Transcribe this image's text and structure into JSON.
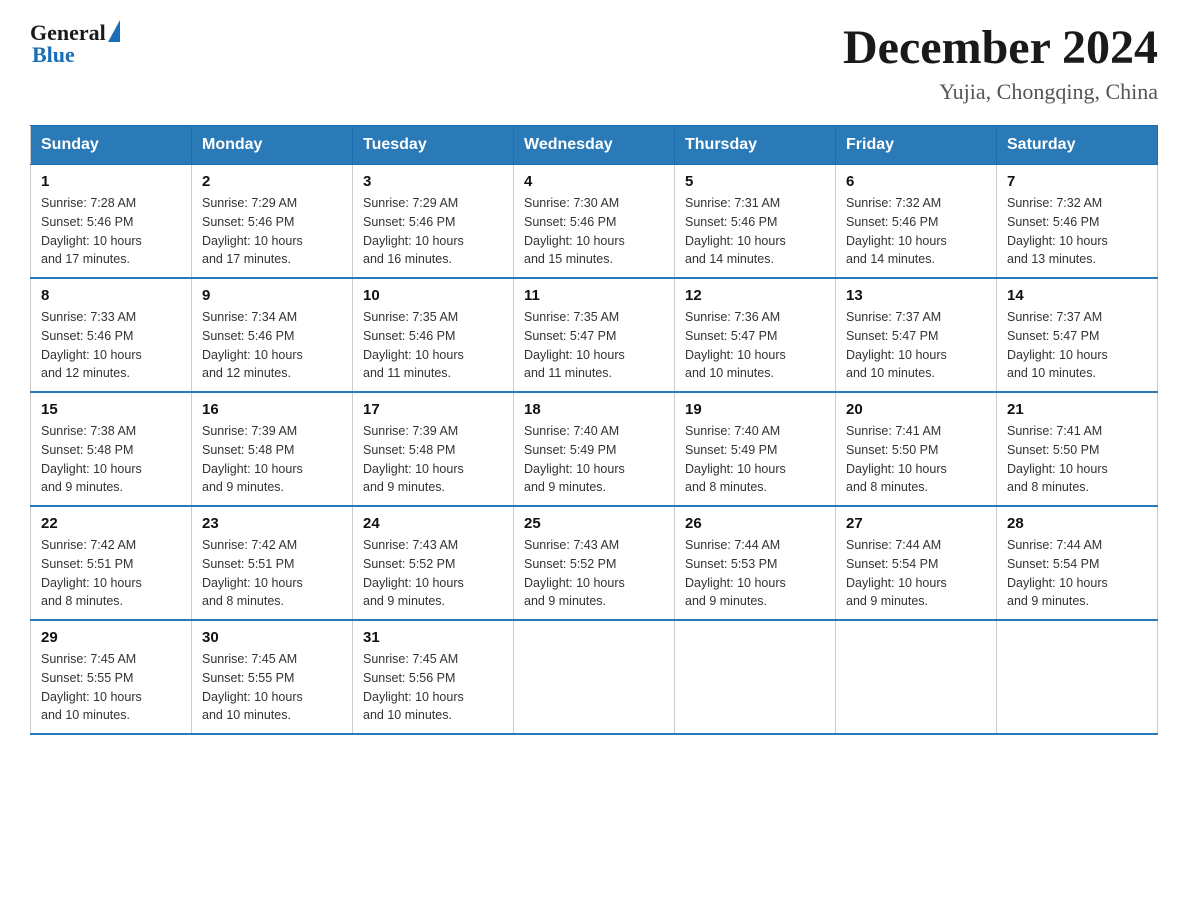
{
  "header": {
    "title": "December 2024",
    "subtitle": "Yujia, Chongqing, China",
    "logo_general": "General",
    "logo_blue": "Blue"
  },
  "weekdays": [
    "Sunday",
    "Monday",
    "Tuesday",
    "Wednesday",
    "Thursday",
    "Friday",
    "Saturday"
  ],
  "weeks": [
    [
      {
        "day": "1",
        "sunrise": "7:28 AM",
        "sunset": "5:46 PM",
        "daylight": "10 hours and 17 minutes."
      },
      {
        "day": "2",
        "sunrise": "7:29 AM",
        "sunset": "5:46 PM",
        "daylight": "10 hours and 17 minutes."
      },
      {
        "day": "3",
        "sunrise": "7:29 AM",
        "sunset": "5:46 PM",
        "daylight": "10 hours and 16 minutes."
      },
      {
        "day": "4",
        "sunrise": "7:30 AM",
        "sunset": "5:46 PM",
        "daylight": "10 hours and 15 minutes."
      },
      {
        "day": "5",
        "sunrise": "7:31 AM",
        "sunset": "5:46 PM",
        "daylight": "10 hours and 14 minutes."
      },
      {
        "day": "6",
        "sunrise": "7:32 AM",
        "sunset": "5:46 PM",
        "daylight": "10 hours and 14 minutes."
      },
      {
        "day": "7",
        "sunrise": "7:32 AM",
        "sunset": "5:46 PM",
        "daylight": "10 hours and 13 minutes."
      }
    ],
    [
      {
        "day": "8",
        "sunrise": "7:33 AM",
        "sunset": "5:46 PM",
        "daylight": "10 hours and 12 minutes."
      },
      {
        "day": "9",
        "sunrise": "7:34 AM",
        "sunset": "5:46 PM",
        "daylight": "10 hours and 12 minutes."
      },
      {
        "day": "10",
        "sunrise": "7:35 AM",
        "sunset": "5:46 PM",
        "daylight": "10 hours and 11 minutes."
      },
      {
        "day": "11",
        "sunrise": "7:35 AM",
        "sunset": "5:47 PM",
        "daylight": "10 hours and 11 minutes."
      },
      {
        "day": "12",
        "sunrise": "7:36 AM",
        "sunset": "5:47 PM",
        "daylight": "10 hours and 10 minutes."
      },
      {
        "day": "13",
        "sunrise": "7:37 AM",
        "sunset": "5:47 PM",
        "daylight": "10 hours and 10 minutes."
      },
      {
        "day": "14",
        "sunrise": "7:37 AM",
        "sunset": "5:47 PM",
        "daylight": "10 hours and 10 minutes."
      }
    ],
    [
      {
        "day": "15",
        "sunrise": "7:38 AM",
        "sunset": "5:48 PM",
        "daylight": "10 hours and 9 minutes."
      },
      {
        "day": "16",
        "sunrise": "7:39 AM",
        "sunset": "5:48 PM",
        "daylight": "10 hours and 9 minutes."
      },
      {
        "day": "17",
        "sunrise": "7:39 AM",
        "sunset": "5:48 PM",
        "daylight": "10 hours and 9 minutes."
      },
      {
        "day": "18",
        "sunrise": "7:40 AM",
        "sunset": "5:49 PM",
        "daylight": "10 hours and 9 minutes."
      },
      {
        "day": "19",
        "sunrise": "7:40 AM",
        "sunset": "5:49 PM",
        "daylight": "10 hours and 8 minutes."
      },
      {
        "day": "20",
        "sunrise": "7:41 AM",
        "sunset": "5:50 PM",
        "daylight": "10 hours and 8 minutes."
      },
      {
        "day": "21",
        "sunrise": "7:41 AM",
        "sunset": "5:50 PM",
        "daylight": "10 hours and 8 minutes."
      }
    ],
    [
      {
        "day": "22",
        "sunrise": "7:42 AM",
        "sunset": "5:51 PM",
        "daylight": "10 hours and 8 minutes."
      },
      {
        "day": "23",
        "sunrise": "7:42 AM",
        "sunset": "5:51 PM",
        "daylight": "10 hours and 8 minutes."
      },
      {
        "day": "24",
        "sunrise": "7:43 AM",
        "sunset": "5:52 PM",
        "daylight": "10 hours and 9 minutes."
      },
      {
        "day": "25",
        "sunrise": "7:43 AM",
        "sunset": "5:52 PM",
        "daylight": "10 hours and 9 minutes."
      },
      {
        "day": "26",
        "sunrise": "7:44 AM",
        "sunset": "5:53 PM",
        "daylight": "10 hours and 9 minutes."
      },
      {
        "day": "27",
        "sunrise": "7:44 AM",
        "sunset": "5:54 PM",
        "daylight": "10 hours and 9 minutes."
      },
      {
        "day": "28",
        "sunrise": "7:44 AM",
        "sunset": "5:54 PM",
        "daylight": "10 hours and 9 minutes."
      }
    ],
    [
      {
        "day": "29",
        "sunrise": "7:45 AM",
        "sunset": "5:55 PM",
        "daylight": "10 hours and 10 minutes."
      },
      {
        "day": "30",
        "sunrise": "7:45 AM",
        "sunset": "5:55 PM",
        "daylight": "10 hours and 10 minutes."
      },
      {
        "day": "31",
        "sunrise": "7:45 AM",
        "sunset": "5:56 PM",
        "daylight": "10 hours and 10 minutes."
      },
      null,
      null,
      null,
      null
    ]
  ],
  "labels": {
    "sunrise": "Sunrise:",
    "sunset": "Sunset:",
    "daylight": "Daylight:"
  }
}
